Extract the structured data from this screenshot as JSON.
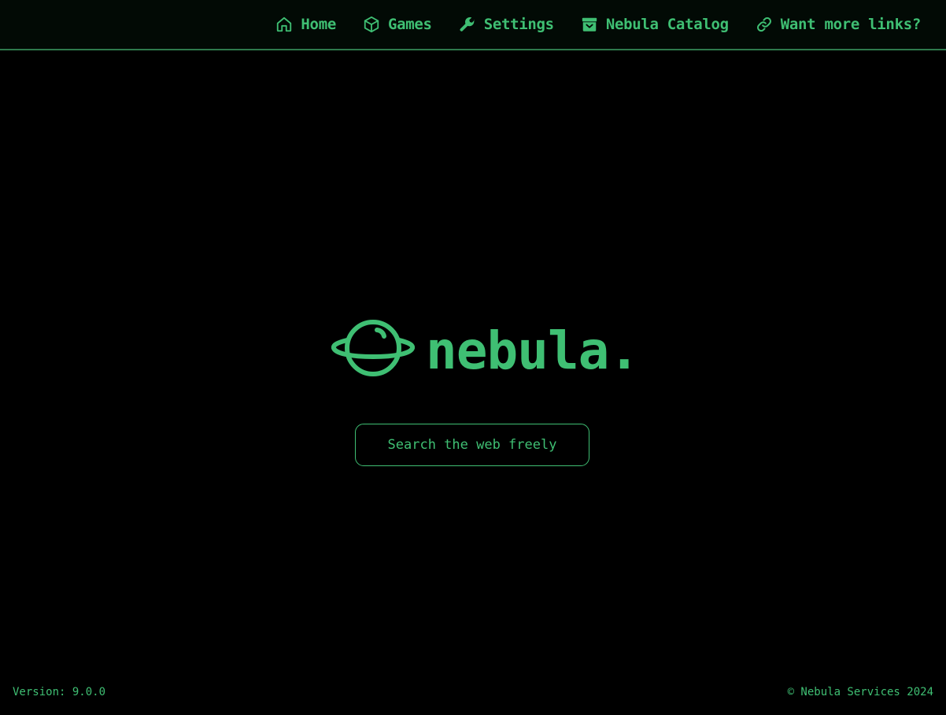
{
  "nav": {
    "items": [
      {
        "label": "Home",
        "icon": "home-icon"
      },
      {
        "label": "Games",
        "icon": "cube-icon"
      },
      {
        "label": "Settings",
        "icon": "wrench-icon"
      },
      {
        "label": "Nebula Catalog",
        "icon": "archive-box-icon"
      },
      {
        "label": "Want more links?",
        "icon": "link-icon"
      }
    ]
  },
  "logo": {
    "text": "nebula.",
    "icon": "planet-icon"
  },
  "search": {
    "placeholder": "Search the web freely",
    "value": ""
  },
  "footer": {
    "version": "Version: 9.0.0",
    "copyright": "© Nebula Services 2024"
  },
  "colors": {
    "accent": "#3fbf73",
    "background": "#000000",
    "topbar": "#020a05",
    "topbar_border": "#2e7a4c"
  }
}
